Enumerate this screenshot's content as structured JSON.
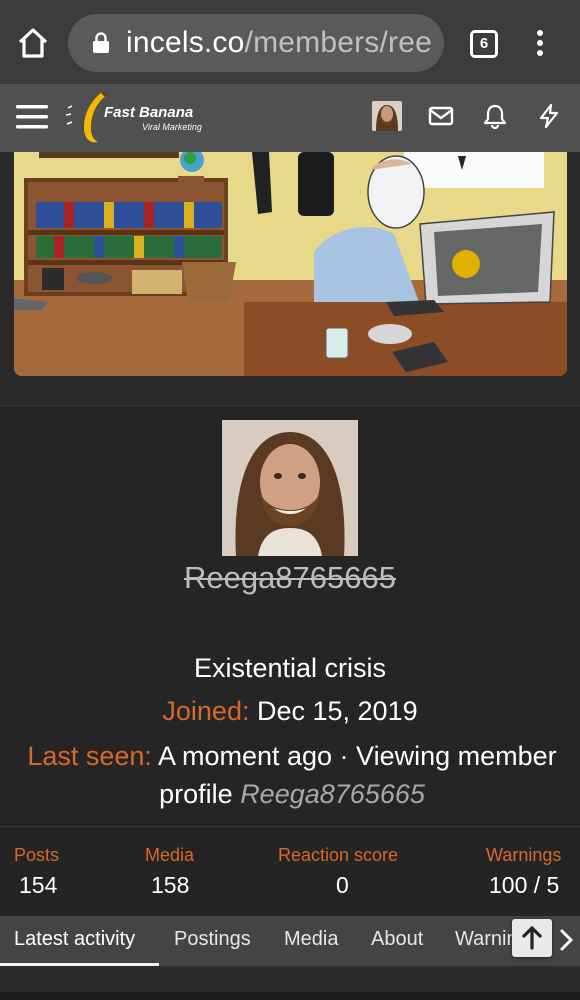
{
  "browser": {
    "url_host": "incels.co",
    "url_path": "/members/ree",
    "tab_count": "6",
    "icons": [
      "home-icon",
      "lock-icon",
      "tabs-icon",
      "overflow-menu-icon"
    ]
  },
  "header": {
    "logo_title": "Fast Banana",
    "logo_subtitle": "Viral Marketing",
    "icons": [
      "menu-icon",
      "mail-icon",
      "bell-icon",
      "lightning-icon"
    ]
  },
  "profile": {
    "username": "Reega8765665",
    "user_title": "Existential crisis",
    "joined_label": "Joined:",
    "joined_value": "Dec 15, 2019",
    "last_seen_label": "Last seen:",
    "last_seen_value": "A moment ago · Viewing member profile",
    "last_seen_target": "Reega8765665"
  },
  "stats": [
    {
      "label": "Posts",
      "value": "154"
    },
    {
      "label": "Media",
      "value": "158"
    },
    {
      "label": "Reaction score",
      "value": "0"
    },
    {
      "label": "Warnings",
      "value": "100 / 5"
    }
  ],
  "tabs": [
    {
      "label": "Latest activity",
      "active": true
    },
    {
      "label": "Postings"
    },
    {
      "label": "Media"
    },
    {
      "label": "About"
    },
    {
      "label": "Warnings"
    }
  ],
  "colors": {
    "accent": "#d7692a",
    "page_bg": "#252525",
    "chrome_bg": "#3c3c3c",
    "header_bg": "#505050",
    "tabbar_bg": "#444444"
  }
}
